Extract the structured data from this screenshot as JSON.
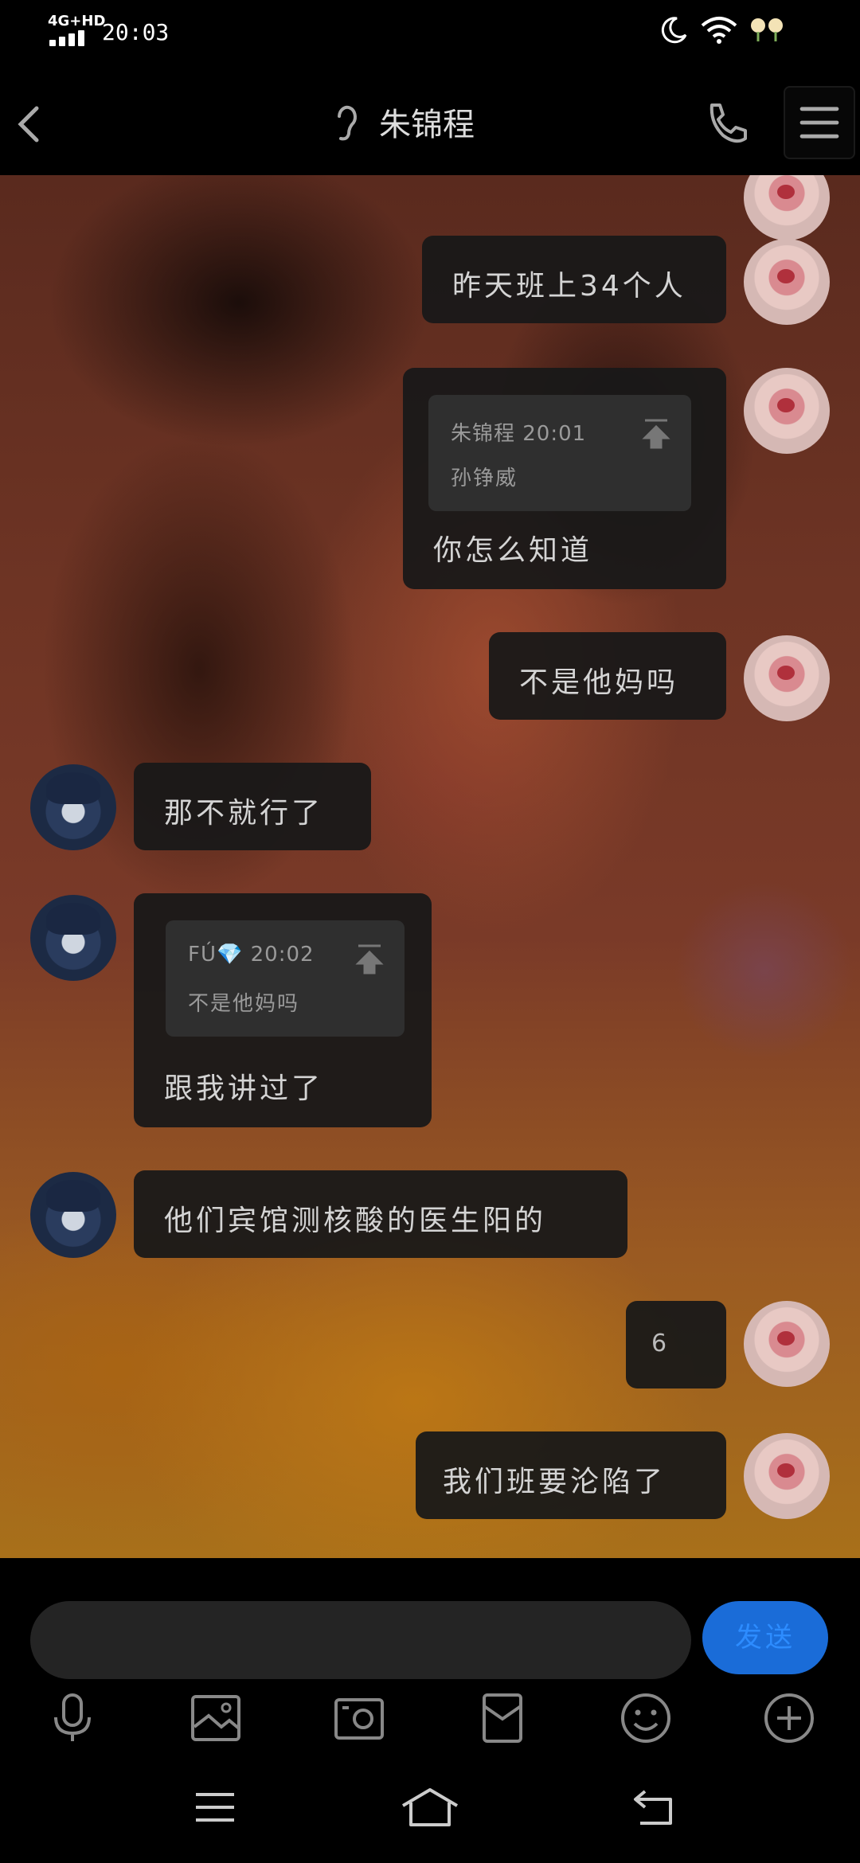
{
  "status_bar": {
    "network": "4G+HD",
    "time": "20:03"
  },
  "title_bar": {
    "contact_name": "朱锦程"
  },
  "messages": [
    {
      "side": "self",
      "text": "昨天班上34个人"
    },
    {
      "side": "self",
      "quote_meta": "朱锦程 20:01",
      "quote_text": "孙铮威",
      "text": "你怎么知道"
    },
    {
      "side": "self",
      "text": "不是他妈吗"
    },
    {
      "side": "other",
      "text": "那不就行了"
    },
    {
      "side": "other",
      "quote_meta": "FÚ💎 20:02",
      "quote_text": "不是他妈吗",
      "text": "跟我讲过了"
    },
    {
      "side": "other",
      "text": "他们宾馆测核酸的医生阳的"
    },
    {
      "side": "self",
      "text": "6"
    },
    {
      "side": "self",
      "text": "我们班要沦陷了"
    }
  ],
  "input": {
    "value": "",
    "send_label": "发送"
  },
  "toolbar": [
    "microphone-icon",
    "image-icon",
    "camera-icon",
    "red-packet-icon",
    "emoji-icon",
    "plus-icon"
  ],
  "nav_bar": [
    "menu-icon",
    "home-icon",
    "back-icon"
  ],
  "colors": {
    "accent": "#1a6cd8",
    "bubble": "#181818"
  }
}
